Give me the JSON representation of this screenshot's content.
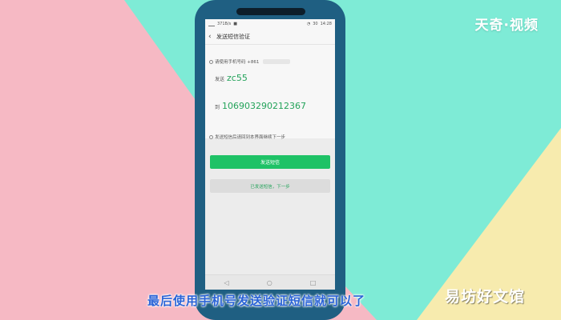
{
  "brand": {
    "logo_text": "天奇·视频"
  },
  "status_bar": {
    "speed": "371B/s",
    "battery": "30",
    "time": "14:28"
  },
  "nav": {
    "title": "发送短信验证"
  },
  "content": {
    "phone_hint": "请使用手机号码 +861",
    "send_label": "发送",
    "send_code": "zc55",
    "to_label": "到",
    "to_number": "106903290212367",
    "after_hint": "发送短信后请回到本界面继续下一步"
  },
  "buttons": {
    "send_sms": "发送短信",
    "sent_next": "已发送短信，下一步"
  },
  "caption": {
    "subtitle": "最后使用手机号发送验证短信就可以了",
    "watermark": "易坊好文馆"
  },
  "colors": {
    "accent_green": "#1ec266",
    "text_green": "#23a35a",
    "subtitle_blue": "#2a63d6"
  }
}
